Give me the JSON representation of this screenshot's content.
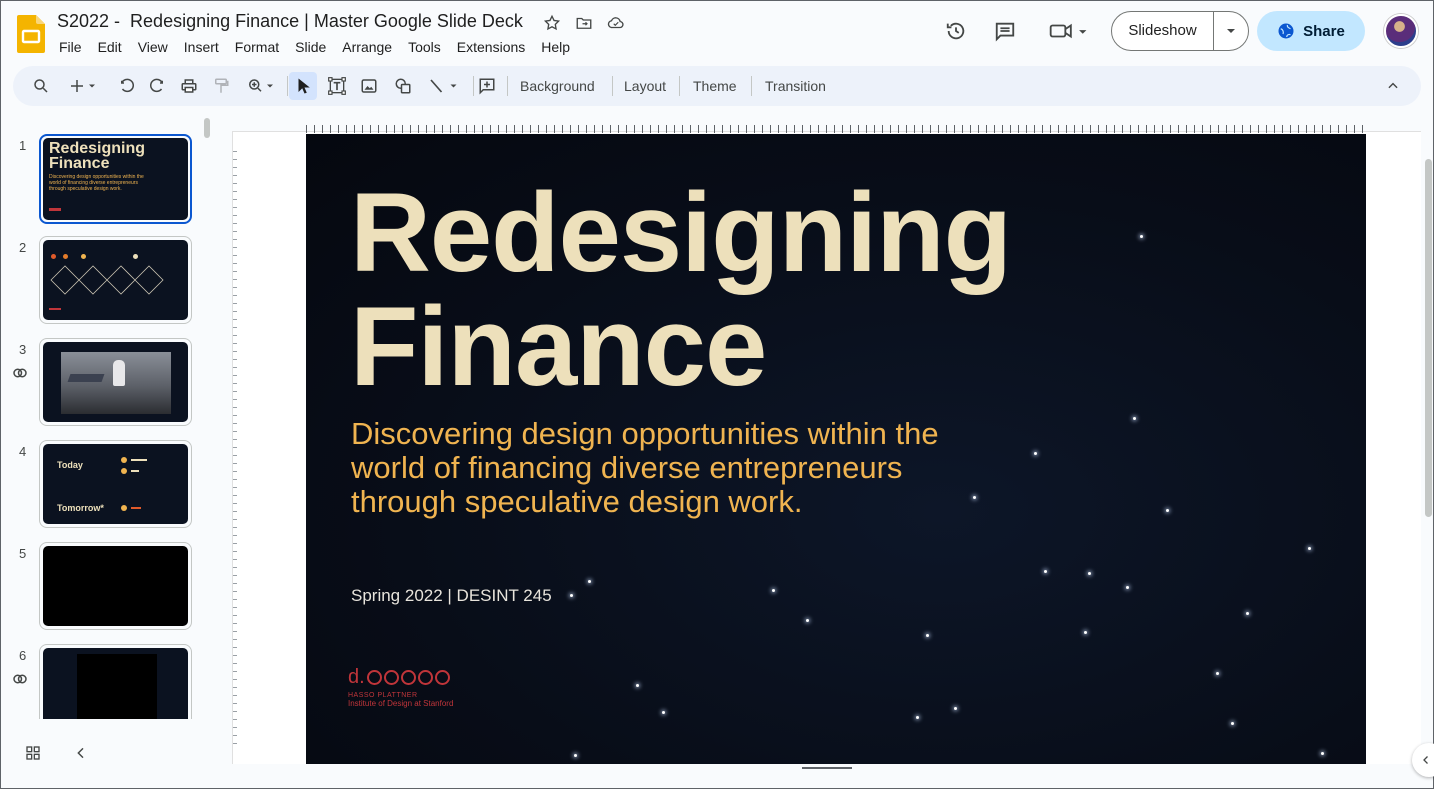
{
  "app": {
    "name": "Google Slides",
    "accent": "#0b57d0",
    "logo_color": "#f4b400"
  },
  "doc": {
    "title": "S2022 -  Redesigning Finance | Master Google Slide Deck"
  },
  "menu": [
    "File",
    "Edit",
    "View",
    "Insert",
    "Format",
    "Slide",
    "Arrange",
    "Tools",
    "Extensions",
    "Help"
  ],
  "header": {
    "slideshow_label": "Slideshow",
    "share_label": "Share"
  },
  "toolbar": {
    "background": "Background",
    "layout": "Layout",
    "theme": "Theme",
    "transition": "Transition"
  },
  "filmstrip": {
    "slides": [
      {
        "num": "1",
        "title": "Redesigning Finance",
        "sub": "Discovering design opportunities within the world of financing diverse entrepreneurs through speculative design work.",
        "linked": false
      },
      {
        "num": "2",
        "linked": false
      },
      {
        "num": "3",
        "linked": true
      },
      {
        "num": "4",
        "today": "Today",
        "tomorrow": "Tomorrow*",
        "linked": false
      },
      {
        "num": "5",
        "linked": false
      },
      {
        "num": "6",
        "linked": true
      }
    ]
  },
  "slide": {
    "title_line1": "Redesigning",
    "title_line2": "Finance",
    "subtitle": "Discovering design opportunities within the world of financing diverse entrepreneurs through speculative design work.",
    "date": "Spring 2022 | DESINT 245",
    "logo_d": "d.",
    "logo_line1": "HASSO PLATTNER",
    "logo_line2": "Institute of Design at Stanford",
    "title_color": "#ede0bb",
    "subtitle_color": "#f0b450",
    "logo_color": "#c0353a"
  }
}
